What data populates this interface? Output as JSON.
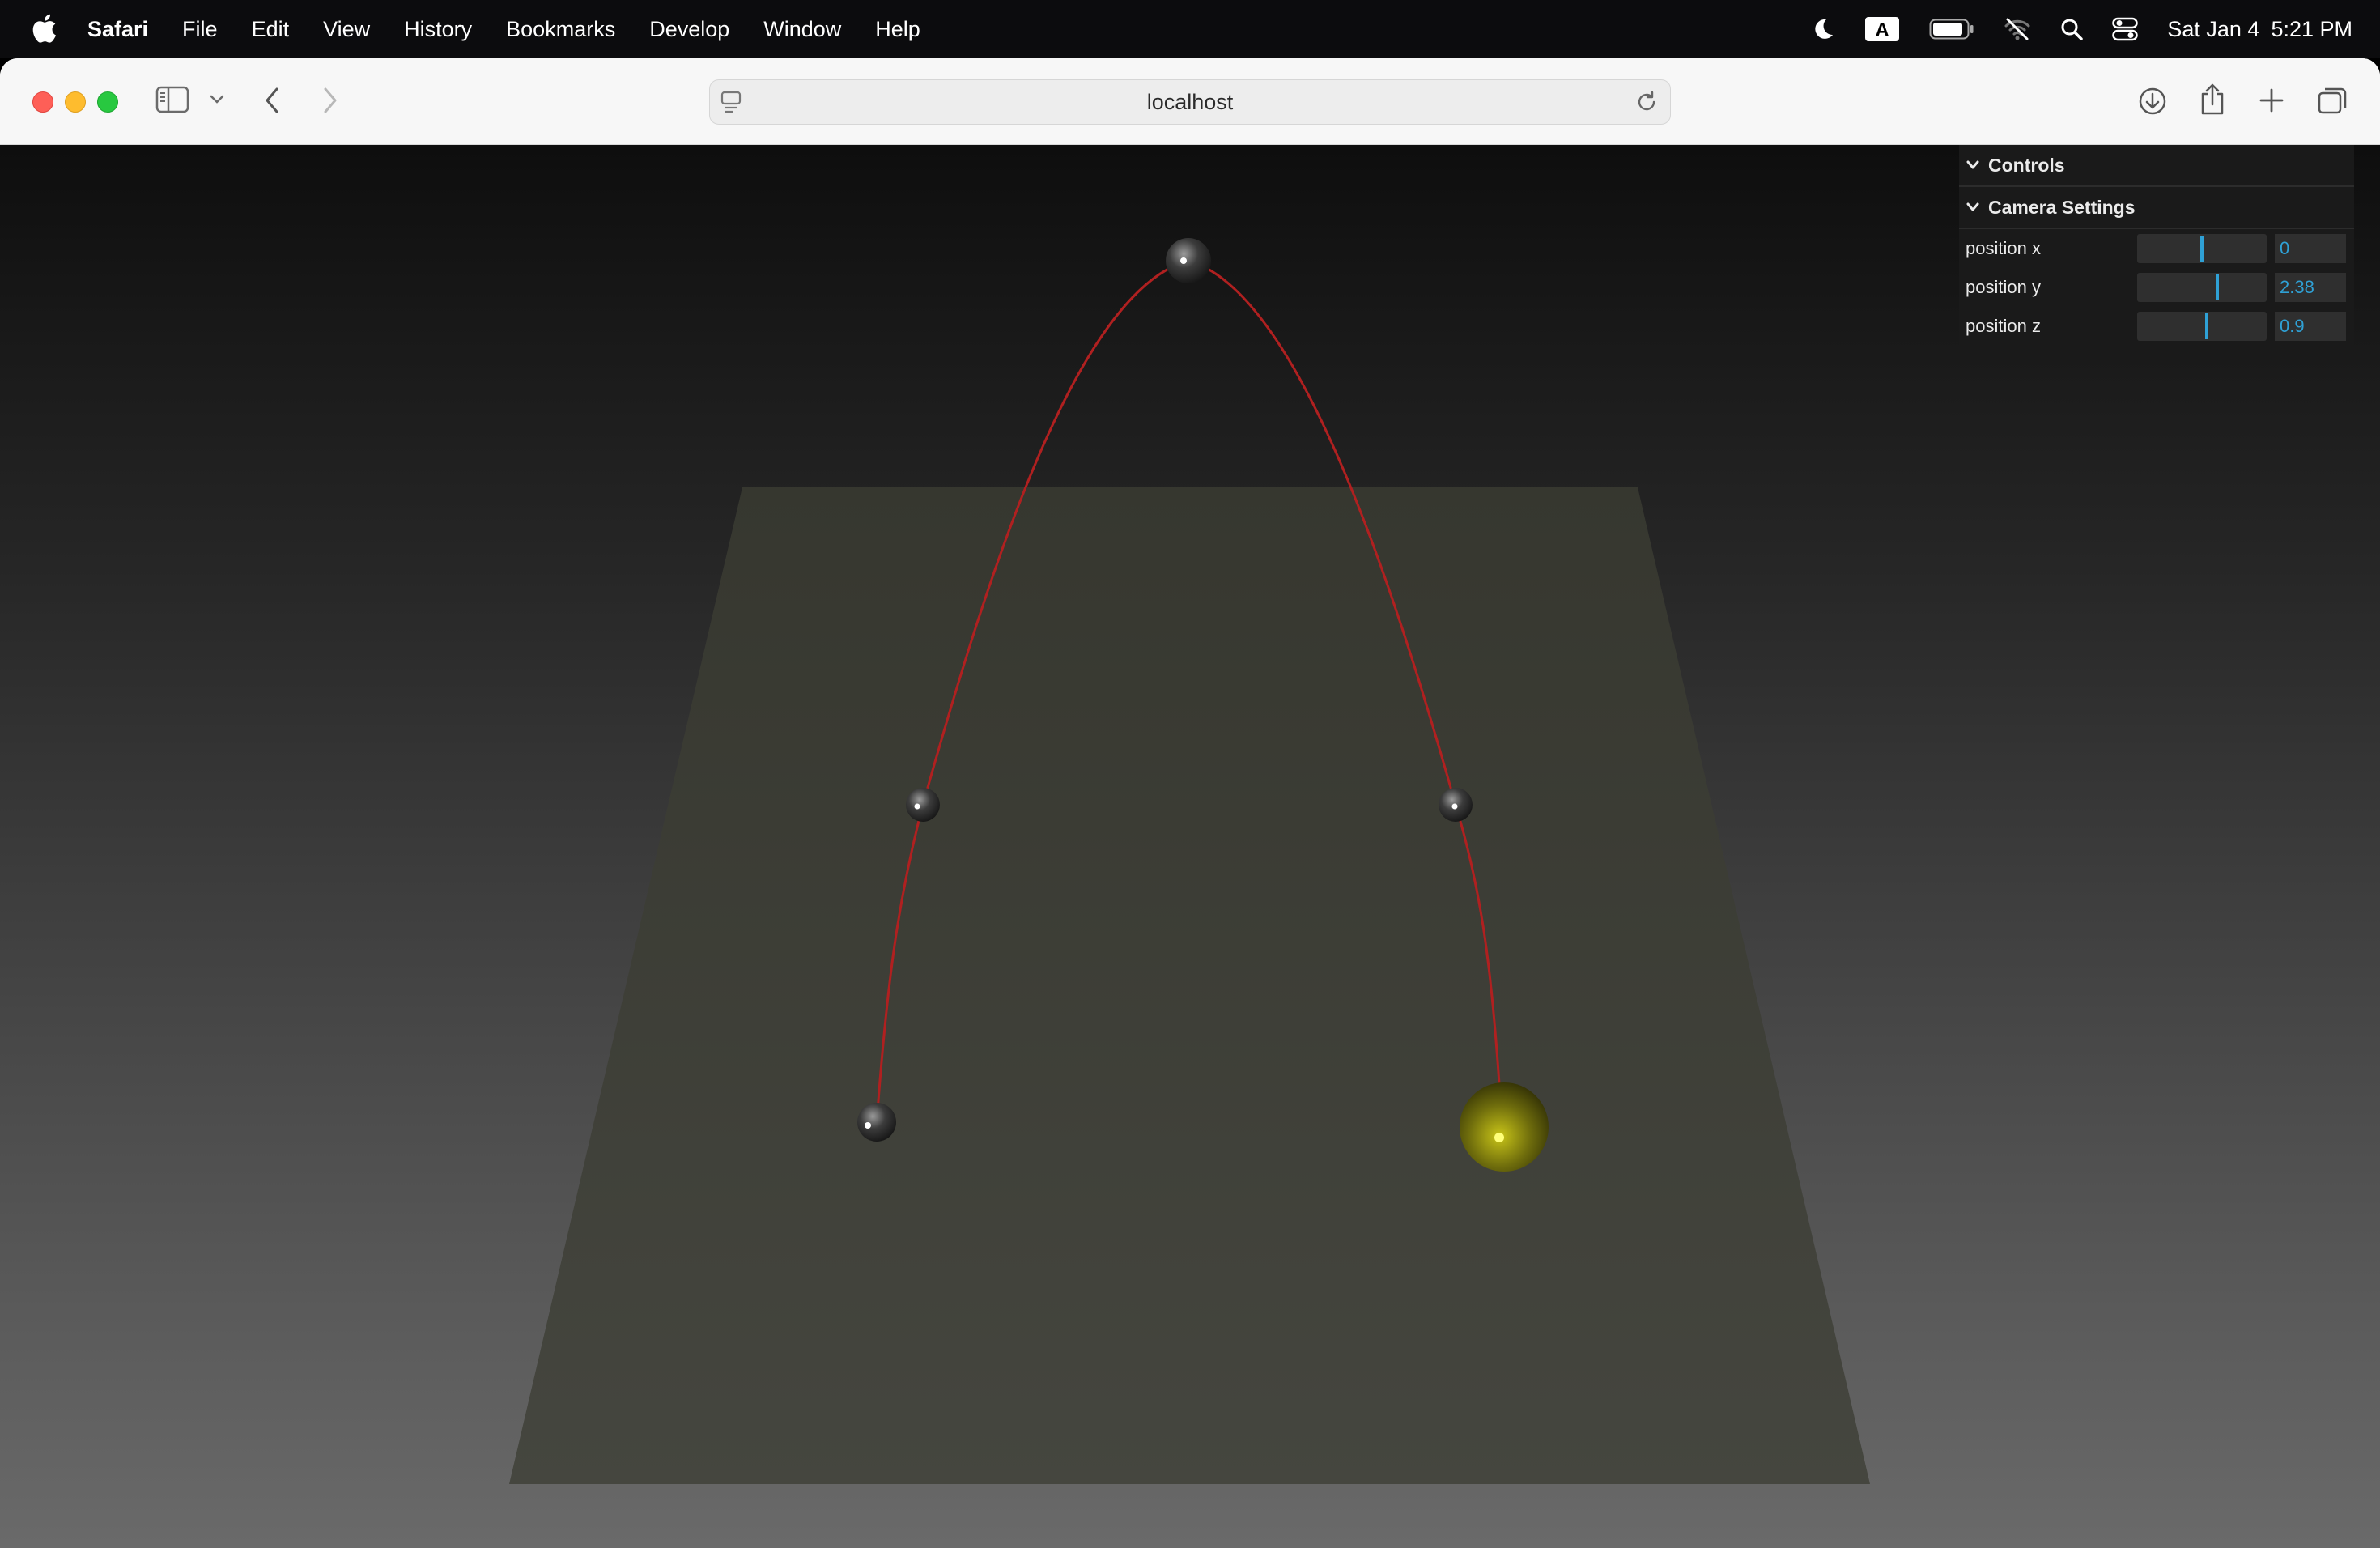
{
  "menubar": {
    "apple_icon": "apple-logo-icon",
    "app_name": "Safari",
    "menus": [
      "File",
      "Edit",
      "View",
      "History",
      "Bookmarks",
      "Develop",
      "Window",
      "Help"
    ],
    "status_icons": [
      "moon-icon",
      "keyboard-input-A-icon",
      "battery-icon",
      "wifi-off-icon",
      "search-icon",
      "control-center-icon"
    ],
    "input_source_letter": "A",
    "date": "Sat Jan 4",
    "time": "5:21 PM"
  },
  "browser": {
    "url": "localhost",
    "icons": [
      "sidebar-icon",
      "chevron-down-icon",
      "back-icon",
      "forward-icon",
      "page-menu-icon",
      "reload-icon",
      "download-icon",
      "share-icon",
      "new-tab-icon",
      "tab-overview-icon"
    ]
  },
  "scene": {
    "background_top": "#0e0e0e",
    "background_bottom": "#6a6a6a",
    "ground_color": "#3b3c38",
    "curve_color": "#b02020",
    "sphere_color": "#3a3a3a",
    "highlight_sphere_color": "#8a8a12",
    "control_points": 5
  },
  "gui": {
    "root_title": "Controls",
    "folder_title": "Camera Settings",
    "rows": [
      {
        "label": "position x",
        "value": "0",
        "fill": 0.5
      },
      {
        "label": "position y",
        "value": "2.38",
        "fill": 0.62
      },
      {
        "label": "position z",
        "value": "0.9",
        "fill": 0.54
      }
    ],
    "accent_color": "#2fa1d6"
  }
}
